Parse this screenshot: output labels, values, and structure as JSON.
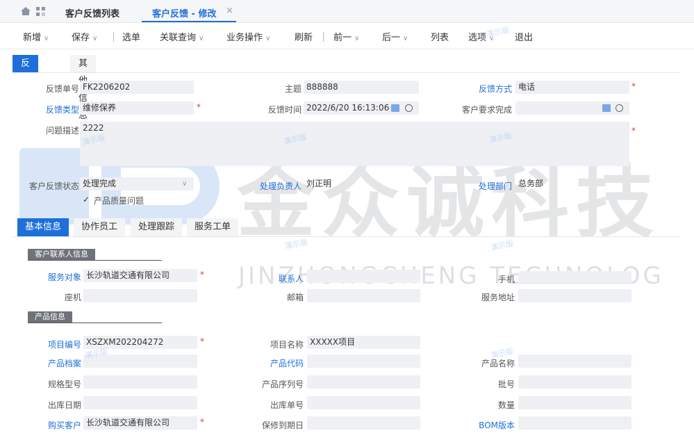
{
  "tabs": {
    "list_label": "客户反馈列表",
    "active_label": "客户反馈 - 修改",
    "close_glyph": "×"
  },
  "toolbar": {
    "new": "新增",
    "save": "保存",
    "select": "选单",
    "related": "关联查询",
    "business": "业务操作",
    "refresh": "刷新",
    "prev": "前一",
    "next": "后一",
    "list": "列表",
    "options": "选项",
    "exit": "退出"
  },
  "form_tabs": {
    "feedback": "反馈信息",
    "other": "其他信息"
  },
  "feedback": {
    "no_label": "反馈单号",
    "no_value": "FK2206202",
    "subject_label": "主题",
    "subject_value": "888888",
    "method_label": "反馈方式",
    "method_value": "电话",
    "type_label": "反馈类型",
    "type_value": "维修保养",
    "time_label": "反馈时间",
    "time_value": "2022/6/20 16:13:06",
    "required_label": "客户要求完成",
    "required_value": "",
    "desc_label": "问题描述",
    "desc_value": "2222",
    "status_label": "客户反馈状态",
    "status_value": "处理完成",
    "owner_label": "处理负责人",
    "owner_value": "刘正明",
    "dept_label": "处理部门",
    "dept_value": "总务部",
    "quality_label": "产品质量问题",
    "quality_checked": "✓"
  },
  "subtabs": {
    "basic": "基本信息",
    "staff": "协作员工",
    "track": "处理跟踪",
    "service": "服务工单"
  },
  "contact": {
    "section": "客户联系人信息",
    "service_label": "服务对象",
    "service_value": "长沙轨道交通有限公司",
    "contact_label": "联系人",
    "contact_value": "",
    "mobile_label": "手机",
    "mobile_value": "",
    "phone_label": "座机",
    "phone_value": "",
    "email_label": "邮箱",
    "email_value": "",
    "address_label": "服务地址",
    "address_value": ""
  },
  "product": {
    "section": "产品信息",
    "pcode_label": "项目编号",
    "pcode_value": "XSZXM202204272",
    "pname_label": "项目名称",
    "pname_value": "XXXXX项目",
    "archive_label": "产品档案",
    "archive_value": "",
    "prodcode_label": "产品代码",
    "prodcode_value": "",
    "prodname_label": "产品名称",
    "prodname_value": "",
    "spec_label": "规格型号",
    "spec_value": "",
    "serial_label": "产品序列号",
    "serial_value": "",
    "batch_label": "批号",
    "batch_value": "",
    "outdate_label": "出库日期",
    "outdate_value": "",
    "outno_label": "出库单号",
    "outno_value": "",
    "qty_label": "数量",
    "qty_value": "",
    "buyer_label": "购买客户",
    "buyer_value": "长沙轨道交通有限公司",
    "warranty_label": "保修到期日",
    "warranty_value": "",
    "bom_label": "BOM版本",
    "bom_value": ""
  },
  "watermark": {
    "demo": "演示版",
    "company_cn": "金众诚科技",
    "company_en": "JINZHONGCHENG TECHNOLOG"
  },
  "colors": {
    "accent": "#1e6fd9",
    "required": "#e53935"
  },
  "icons": [
    "home-icon",
    "grid-icon",
    "calendar-icon",
    "clock-icon",
    "chevron-down-icon",
    "check-icon"
  ]
}
